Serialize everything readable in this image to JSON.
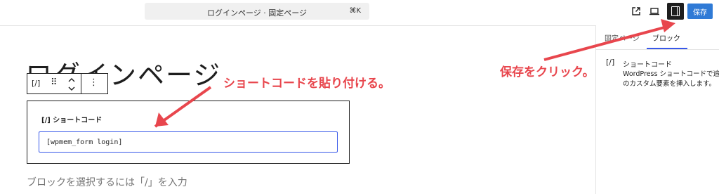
{
  "header": {
    "command_title": "ログインページ · 固定ページ",
    "shortcut": "⌘K",
    "save_label": "保存"
  },
  "sidebar": {
    "tabs": [
      {
        "label": "固定ページ"
      },
      {
        "label": "ブロック"
      }
    ],
    "active_tab": "ブロック",
    "block_icon": "[/]",
    "block_name": "ショートコード",
    "description_line1": "WordPress ショートコードで追加",
    "description_line2": "のカスタム要素を挿入します。"
  },
  "editor": {
    "page_title": "ログインページ",
    "block_toolbar": {
      "type_icon": "[/]",
      "drag_icon": "⠿",
      "more_icon": "⋮"
    },
    "shortcode_block": {
      "label": "[/] ショートコード",
      "value": "[wpmem_form login]"
    },
    "placeholder": "ブロックを選択するには「/」を入力"
  },
  "annotations": {
    "paste_note": "ショートコードを貼り付ける。",
    "save_note": "保存をクリック。",
    "color": "#e8464d"
  },
  "colors": {
    "accent": "#3858e9",
    "save_button": "#2f7ad6"
  }
}
